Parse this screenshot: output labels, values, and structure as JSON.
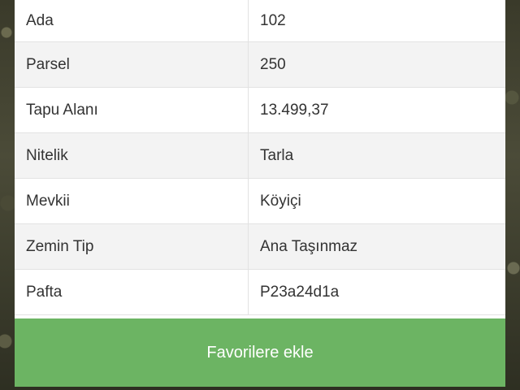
{
  "details": {
    "rows": [
      {
        "key": "Ada",
        "value": "102"
      },
      {
        "key": "Parsel",
        "value": "250"
      },
      {
        "key": "Tapu Alanı",
        "value": "13.499,37"
      },
      {
        "key": "Nitelik",
        "value": "Tarla"
      },
      {
        "key": "Mevkii",
        "value": "Köyiçi"
      },
      {
        "key": "Zemin Tip",
        "value": "Ana Taşınmaz"
      },
      {
        "key": "Pafta",
        "value": "P23a24d1a"
      }
    ]
  },
  "actions": {
    "favorite_label": "Favorilere ekle",
    "favorite_color": "#6cb463"
  }
}
